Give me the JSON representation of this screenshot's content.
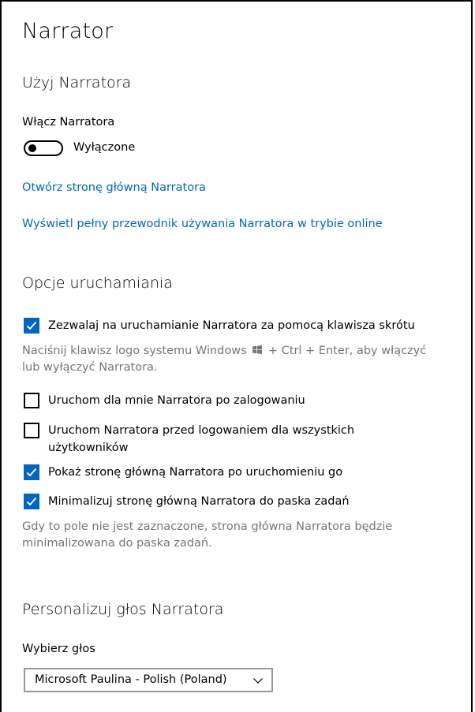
{
  "page_title": "Narrator",
  "use_narrator": {
    "title": "Użyj Narratora",
    "toggle_label": "Włącz Narratora",
    "toggle_state_text": "Wyłączone",
    "toggle_on": false,
    "link_home": "Otwórz stronę główną Narratora",
    "link_guide": "Wyświetl pełny przewodnik używania Narratora w trybie online"
  },
  "startup": {
    "title": "Opcje uruchamiania",
    "shortcut_label": "Zezwalaj na uruchamianie Narratora za pomocą klawisza skrótu",
    "shortcut_checked": true,
    "shortcut_help_part1": "Naciśnij klawisz logo systemu Windows",
    "shortcut_help_part2": "+ Ctrl + Enter, aby włączyć lub wyłączyć Narratora.",
    "start_after_login_label": "Uruchom dla mnie Narratora po zalogowaniu",
    "start_after_login_checked": false,
    "start_before_login_label": "Uruchom Narratora przed logowaniem dla wszystkich użytkowników",
    "start_before_login_checked": false,
    "show_home_label": "Pokaż stronę główną Narratora po uruchomieniu go",
    "show_home_checked": true,
    "minimize_home_label": "Minimalizuj stronę główną Narratora do paska zadań",
    "minimize_home_checked": true,
    "minimize_help": "Gdy to pole nie jest zaznaczone, strona główna Narratora będzie minimalizowana do paska zadań."
  },
  "voice": {
    "title": "Personalizuj głos Narratora",
    "choose_label": "Wybierz głos",
    "selected_voice": "Microsoft Paulina - Polish (Poland)"
  },
  "colors": {
    "accent": "#0067c0",
    "help_text": "#767676"
  },
  "icons": {
    "windows_logo": "windows-logo-icon",
    "checkmark": "checkmark-icon",
    "chevron": "chevron-down-icon"
  }
}
